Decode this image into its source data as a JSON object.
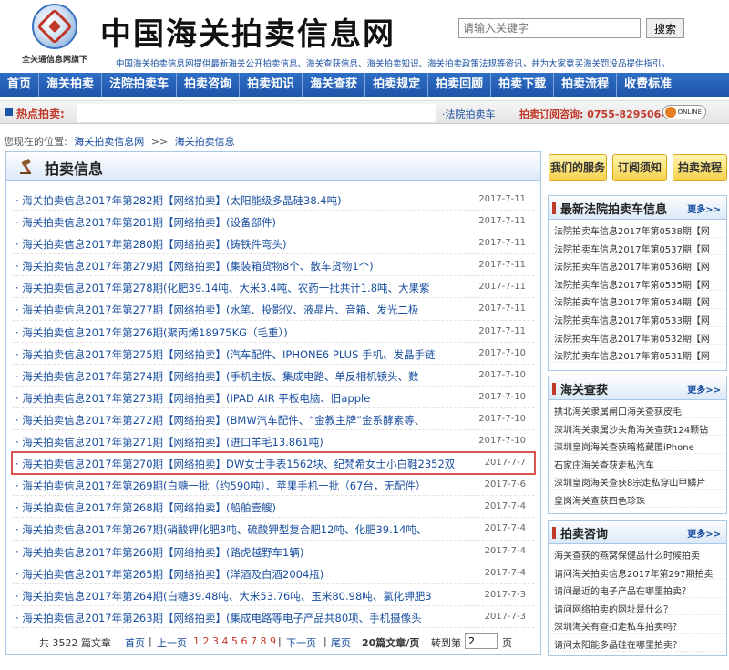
{
  "header": {
    "logo_caption": "全关通信息网旗下",
    "site_title": "中国海关拍卖信息网",
    "search_placeholder": "请输入关键字",
    "search_button": "搜索",
    "tagline": "中国海关拍卖信息网提供最新海关公开拍卖信息、海关查获信息、海关拍卖知识、海关拍卖政策法规等资讯，并为大家竟买海关罚没品提供指引。"
  },
  "nav": [
    "首页",
    "海关拍卖",
    "法院拍卖车",
    "拍卖咨询",
    "拍卖知识",
    "海关查获",
    "拍卖规定",
    "拍卖回顾",
    "拍卖下载",
    "拍卖流程",
    "收费标准"
  ],
  "hotbar": {
    "label": "热点拍卖:",
    "link": "·法院拍卖车",
    "phone": "拍卖订阅咨询: 0755-82950641",
    "online": "ONLINE"
  },
  "breadcrumb": {
    "prefix": "您现在的位置:",
    "home": "海关拍卖信息网",
    "sep": ">>",
    "current": "海关拍卖信息"
  },
  "main": {
    "title": "拍卖信息",
    "rows": [
      {
        "title": "· 海关拍卖信息2017年第282期【网络拍卖】(太阳能级多晶硅38.4吨)",
        "date": "2017-7-11"
      },
      {
        "title": "· 海关拍卖信息2017年第281期【网络拍卖】(设备部件)",
        "date": "2017-7-11"
      },
      {
        "title": "· 海关拍卖信息2017年第280期【网络拍卖】(铸铁件弯头)",
        "date": "2017-7-11"
      },
      {
        "title": "· 海关拍卖信息2017年第279期【网络拍卖】(集装箱货物8个、散车货物1个)",
        "date": "2017-7-11"
      },
      {
        "title": "· 海关拍卖信息2017年第278期(化肥39.14吨、大米3.4吨、农药一批共计1.8吨、大果紫",
        "date": "2017-7-11"
      },
      {
        "title": "· 海关拍卖信息2017年第277期【网络拍卖】(水笔、投影仪、液晶片、音箱、发光二极",
        "date": "2017-7-11"
      },
      {
        "title": "· 海关拍卖信息2017年第276期(聚丙烯18975KG（毛重）)",
        "date": "2017-7-11"
      },
      {
        "title": "· 海关拍卖信息2017年第275期【网络拍卖】(汽车配件、IPHONE6  PLUS  手机、发晶手链",
        "date": "2017-7-10"
      },
      {
        "title": "· 海关拍卖信息2017年第274期【网络拍卖】(手机主板、集成电路、单反相机镜头、数",
        "date": "2017-7-10"
      },
      {
        "title": "· 海关拍卖信息2017年第273期【网络拍卖】(IPAD  AIR  平板电脑、旧apple",
        "date": "2017-7-10"
      },
      {
        "title": "· 海关拍卖信息2017年第272期【网络拍卖】(BMW汽车配件、“金教主牌”金系酵素等、",
        "date": "2017-7-10"
      },
      {
        "title": "· 海关拍卖信息2017年第271期【网络拍卖】(进口羊毛13.861吨)",
        "date": "2017-7-10"
      },
      {
        "title": "· 海关拍卖信息2017年第270期【网络拍卖】DW女士手表1562块、纪梵希女士小白鞋2352双",
        "date": "2017-7-7"
      },
      {
        "title": "· 海关拍卖信息2017年第269期(白糖一批（约590吨）、苹果手机一批（67台，无配件）",
        "date": "2017-7-6"
      },
      {
        "title": "· 海关拍卖信息2017年第268期【网络拍卖】(船舶壹艘)",
        "date": "2017-7-4"
      },
      {
        "title": "· 海关拍卖信息2017年第267期(硝酸钾化肥3吨、硫酸钾型复合肥12吨、化肥39.14吨、",
        "date": "2017-7-4"
      },
      {
        "title": "· 海关拍卖信息2017年第266期【网络拍卖】(路虎越野车1辆)",
        "date": "2017-7-4"
      },
      {
        "title": "· 海关拍卖信息2017年第265期【网络拍卖】(洋酒及白酒2004瓶)",
        "date": "2017-7-4"
      },
      {
        "title": "· 海关拍卖信息2017年第264期(白糖39.48吨、大米53.76吨、玉米80.98吨、氯化钾肥3",
        "date": "2017-7-3"
      },
      {
        "title": "· 海关拍卖信息2017年第263期【网络拍卖】(集成电路等电子产品共80项、手机摄像头",
        "date": "2017-7-3"
      }
    ],
    "pager": {
      "total": "共 3522 篇文章",
      "first": "首页",
      "prev": "上一页",
      "pages": "1 2 3 4 5 6 7 8 9",
      "next": "下一页",
      "last": "尾页",
      "per_page": "20篇文章/页",
      "goto": "转到第",
      "page_value": "2",
      "page_suffix": "页"
    }
  },
  "side_buttons": [
    "我们的服务",
    "订阅须知",
    "拍卖流程"
  ],
  "panels": [
    {
      "title": "最新法院拍卖车信息",
      "more": "更多>>",
      "items": [
        "法院拍卖车信息2017年第0538期【网",
        "法院拍卖车信息2017年第0537期【网",
        "法院拍卖车信息2017年第0536期【网",
        "法院拍卖车信息2017年第0535期【网",
        "法院拍卖车信息2017年第0534期【网",
        "法院拍卖车信息2017年第0533期【网",
        "法院拍卖车信息2017年第0532期【网",
        "法院拍卖车信息2017年第0531期【网"
      ]
    },
    {
      "title": "海关查获",
      "more": "更多>>",
      "items": [
        "拱北海关隶属闸口海关查获皮毛",
        "深圳海关隶属沙头角海关查获124颗钻",
        "深圳皇岗海关查获暗格藏匿iPhone",
        "石家庄海关查获走私汽车",
        "深圳皇岗海关查获8宗走私穿山甲鳞片",
        "皇岗海关查获四色珍珠"
      ]
    },
    {
      "title": "拍卖咨询",
      "more": "更多>>",
      "items": [
        "海关查获的燕窝保健品什么时候拍卖",
        "请问海关拍卖信息2017年第297期拍卖",
        "请问最近的电子产品在哪里拍卖？",
        "请问网络拍卖的网址是什么？",
        "深圳海关有查扣走私车拍卖吗？",
        "请问太阳能多晶硅在哪里拍卖？"
      ]
    }
  ],
  "colors": {
    "nav_blue": "#1d55a8",
    "link_blue": "#1a4fa0",
    "highlight_red": "#d9534f",
    "button_gold": "#f7d04a"
  }
}
